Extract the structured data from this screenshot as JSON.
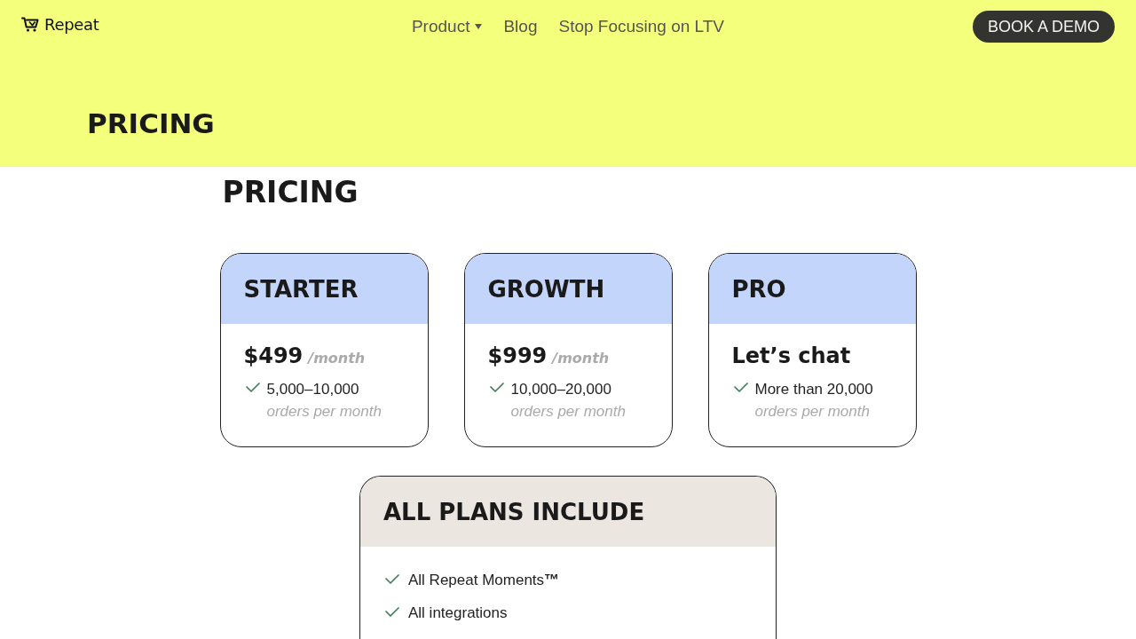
{
  "nav": {
    "logo": "Repeat",
    "links": [
      {
        "label": "Product",
        "dropdown": true
      },
      {
        "label": "Blog",
        "dropdown": false
      },
      {
        "label": "Stop Focusing on LTV",
        "dropdown": false
      }
    ],
    "cta": "BOOK A DEMO"
  },
  "hero": {
    "title": "PRICING"
  },
  "section": {
    "title": "PRICING"
  },
  "plans": [
    {
      "name": "STARTER",
      "price": "$499",
      "period": "/month",
      "features": [
        {
          "text": "5,000–10,000",
          "note": "orders per month"
        }
      ]
    },
    {
      "name": "GROWTH",
      "price": "$999",
      "period": "/month",
      "features": [
        {
          "text": "10,000–20,000",
          "note": "orders per month"
        }
      ]
    },
    {
      "name": "PRO",
      "price": "Let’s chat",
      "features": [
        {
          "text": "More than 20,000",
          "note": "orders per month"
        }
      ]
    }
  ],
  "all_plans": {
    "title": "ALL PLANS INCLUDE",
    "features": [
      "All Repeat Moments**™**",
      "All integrations"
    ]
  }
}
